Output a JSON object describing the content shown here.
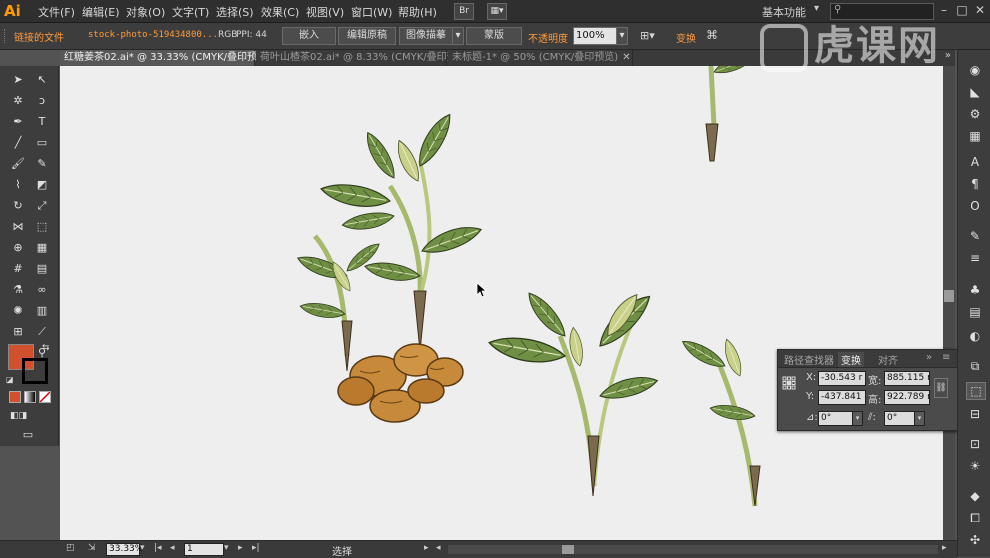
{
  "app": {
    "logo": "Ai"
  },
  "menu": [
    "文件(F)",
    "编辑(E)",
    "对象(O)",
    "文字(T)",
    "选择(S)",
    "效果(C)",
    "视图(V)",
    "窗口(W)",
    "帮助(H)"
  ],
  "menubar": {
    "bridge_label": "Br",
    "workspace": "基本功能",
    "search_placeholder": ""
  },
  "control_bar": {
    "linked_file": "链接的文件",
    "file_name": "stock-photo-519434800...",
    "color_mode": "RGB",
    "ppi": "PPI: 44",
    "embed": "嵌入",
    "edit_original": "编辑原稿",
    "image_trace": "图像描摹",
    "mask": "蒙版",
    "opacity_label": "不透明度",
    "opacity_value": "100%",
    "transform_label": "变换"
  },
  "tabs": [
    {
      "label": "红糖姜茶02.ai* @ 33.33% (CMYK/叠印预览)",
      "active": true
    },
    {
      "label": "荷叶山楂茶02.ai* @ 8.33% (CMYK/叠印预览)",
      "active": false
    },
    {
      "label": "未标题-1* @ 50% (CMYK/叠印预览)",
      "active": false
    }
  ],
  "transform_panel": {
    "tabs": [
      "路径查找器",
      "变换",
      "对齐"
    ],
    "x_label": "X:",
    "x_value": "-30.543 r",
    "y_label": "Y:",
    "y_value": "-437.841",
    "w_label": "宽:",
    "w_value": "885.115 r",
    "h_label": "高:",
    "h_value": "922.789 r",
    "angle_value": "0°",
    "shear_value": "0°"
  },
  "status_bar": {
    "zoom": "33.33%",
    "artboard": "1",
    "tool_mode": "选择"
  },
  "watermark": "虎课网",
  "colors": {
    "fill": "#d0502f",
    "stroke": "#000000",
    "accent": "#ff9a00"
  }
}
